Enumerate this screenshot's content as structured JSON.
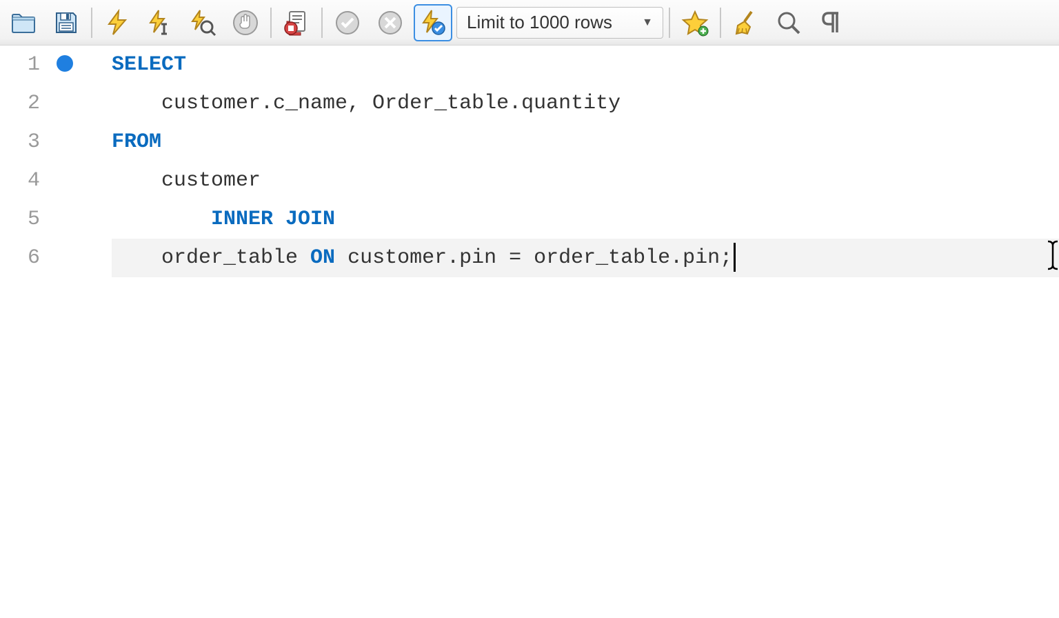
{
  "toolbar": {
    "limit_label": "Limit to 1000 rows"
  },
  "editor": {
    "lines": {
      "1": {
        "kw1": "SELECT"
      },
      "2": {
        "t1": "    customer.c_name, Order_table.quantity"
      },
      "3": {
        "kw1": "FROM"
      },
      "4": {
        "t1": "    customer"
      },
      "5": {
        "kw1": "        INNER JOIN"
      },
      "6": {
        "t1": "    order_table ",
        "kw1": "ON",
        "t2": " customer.pin = order_table.pin;"
      }
    },
    "line_numbers": {
      "1": "1",
      "2": "2",
      "3": "3",
      "4": "4",
      "5": "5",
      "6": "6"
    }
  }
}
